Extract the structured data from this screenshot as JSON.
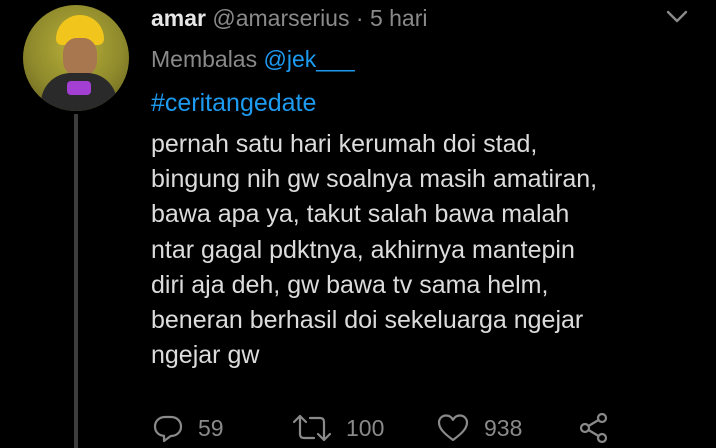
{
  "tweet": {
    "name": "amar",
    "handle": "@amarserius",
    "separator": "·",
    "time": "5 hari",
    "reply_prefix": "Membalas",
    "reply_to": "@jek___",
    "hashtag": "#ceritangedate",
    "body_lines": [
      "pernah satu hari kerumah doi stad,",
      "bingung nih gw soalnya masih amatiran,",
      "bawa apa ya, takut salah bawa malah",
      "ntar gagal pdktnya, akhirnya mantepin",
      "diri aja deh, gw bawa tv sama helm,",
      "beneran berhasil doi sekeluarga ngejar",
      "ngejar gw"
    ]
  },
  "actions": {
    "replies": "59",
    "retweets": "100",
    "likes": "938"
  },
  "colors": {
    "background": "#000000",
    "link": "#1d9bf0",
    "muted": "#8a8a8a",
    "text": "#dcdcdc"
  },
  "icons": [
    "reply-icon",
    "retweet-icon",
    "like-icon",
    "share-icon",
    "chevron-down-icon"
  ]
}
